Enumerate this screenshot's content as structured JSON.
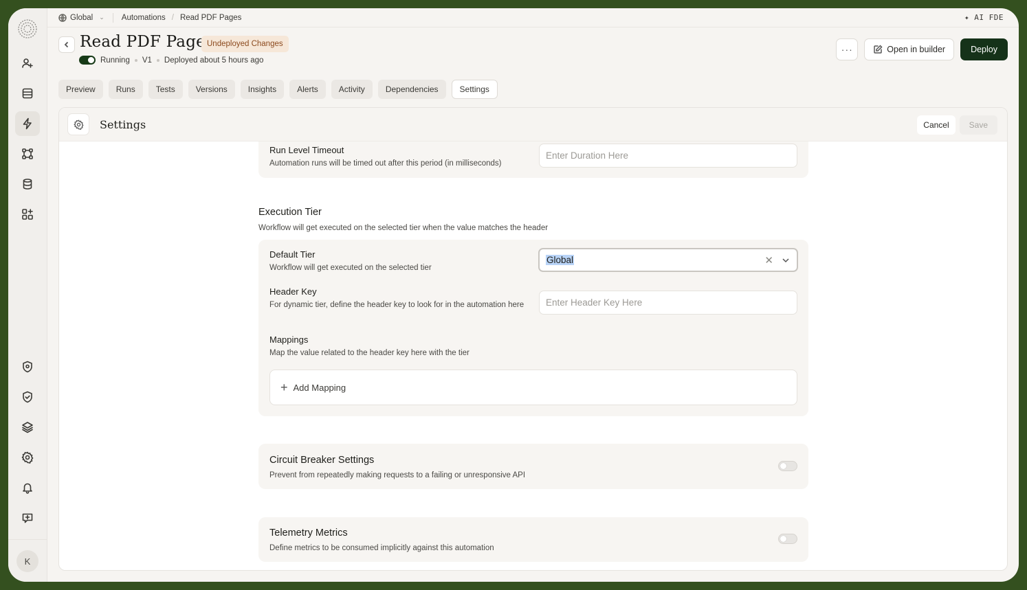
{
  "topbar": {
    "workspace": "Global",
    "breadcrumb_1": "Automations",
    "breadcrumb_2": "Read PDF Pages",
    "ai_label": "AI FDE"
  },
  "header": {
    "title": "Read PDF Pages",
    "badge": "Undeployed Changes",
    "status": "Running",
    "version": "V1",
    "deployed": "Deployed about 5 hours ago",
    "more_label": "···",
    "open_builder": "Open in builder",
    "deploy": "Deploy"
  },
  "tabs": [
    "Preview",
    "Runs",
    "Tests",
    "Versions",
    "Insights",
    "Alerts",
    "Activity",
    "Dependencies",
    "Settings"
  ],
  "active_tab": "Settings",
  "settings": {
    "title": "Settings",
    "cancel": "Cancel",
    "save": "Save",
    "run_timeout": {
      "label": "Run Level Timeout",
      "desc": "Automation runs will be timed out after this period (in milliseconds)",
      "placeholder": "Enter Duration Here"
    },
    "execution_tier": {
      "title": "Execution Tier",
      "desc": "Workflow will get executed on the selected tier when the value matches the header",
      "default_tier_label": "Default Tier",
      "default_tier_desc": "Workflow will get executed on the selected tier",
      "default_tier_value": "Global",
      "header_key_label": "Header Key",
      "header_key_desc": "For dynamic tier, define the header key to look for in the automation here",
      "header_key_placeholder": "Enter Header Key Here",
      "mappings_label": "Mappings",
      "mappings_desc": "Map the value related to the header key here with the tier",
      "add_mapping": "Add Mapping"
    },
    "circuit_breaker": {
      "title": "Circuit Breaker Settings",
      "desc": "Prevent from repeatedly making requests to a failing or unresponsive API",
      "enabled": false
    },
    "telemetry": {
      "title": "Telemetry Metrics",
      "desc": "Define metrics to be consumed implicitly against this automation",
      "enabled": false
    }
  },
  "user": {
    "initial": "K"
  },
  "colors": {
    "accent": "#153219",
    "badge_bg": "#f6e7d8",
    "badge_text": "#8c4a1e",
    "frame": "#34501f"
  }
}
